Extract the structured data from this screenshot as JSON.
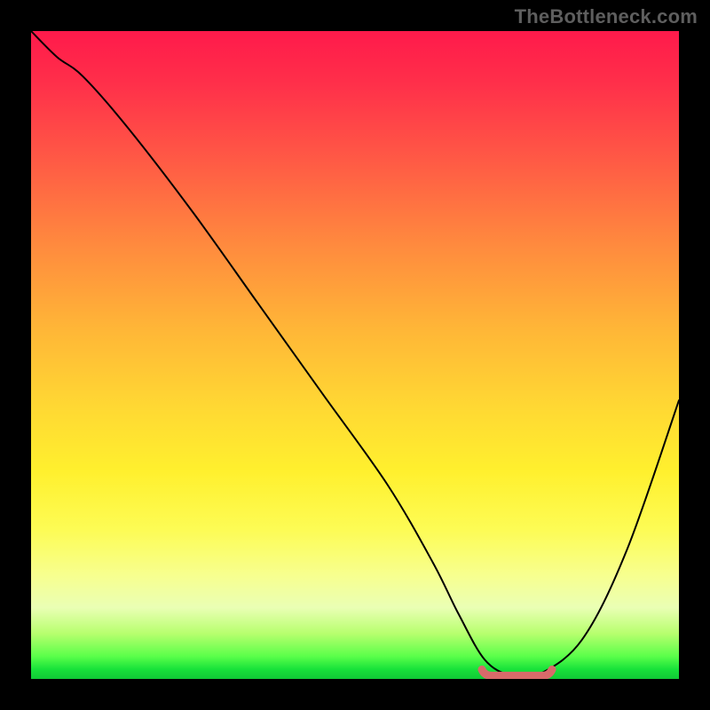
{
  "watermark": "TheBottleneck.com",
  "colors": {
    "frame_bg": "#000000",
    "gradient_top": "#ff1a4b",
    "gradient_bottom": "#11c936",
    "curve_stroke": "#000000",
    "valley_highlight": "#d86a6a"
  },
  "chart_data": {
    "type": "line",
    "title": "",
    "xlabel": "",
    "ylabel": "",
    "xlim": [
      0,
      100
    ],
    "ylim": [
      0,
      100
    ],
    "grid": false,
    "note": "Background heat: green (bottom, y≈0) through yellow/orange to red (top, y≈100). Curve shows bottleneck severity vs x; minimum highlighted in salmon.",
    "series": [
      {
        "name": "curve",
        "x": [
          0,
          4,
          8,
          15,
          25,
          35,
          45,
          55,
          62,
          66,
          70,
          74,
          78,
          85,
          92,
          100
        ],
        "y": [
          100,
          96,
          93,
          85,
          72,
          58,
          44,
          30,
          18,
          10,
          3,
          0.5,
          0.5,
          6,
          20,
          43
        ]
      }
    ],
    "valley": {
      "x_start": 70,
      "x_end": 80,
      "y": 0.5
    }
  }
}
